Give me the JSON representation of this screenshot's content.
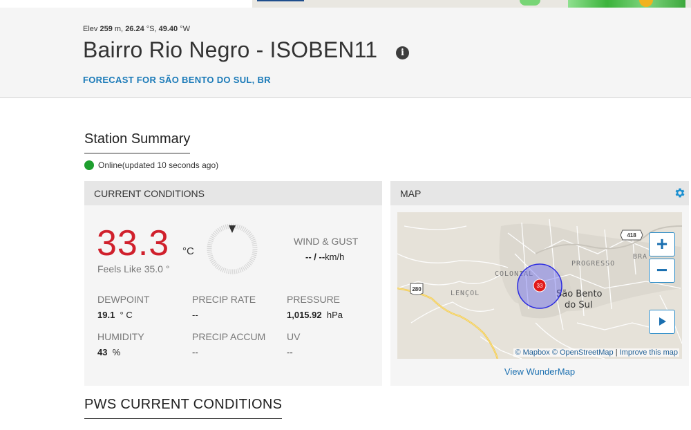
{
  "header": {
    "elev_label": "Elev",
    "elev_value": "259",
    "elev_unit": "m,",
    "lat_value": "26.24",
    "lat_unit": "°S,",
    "lon_value": "49.40",
    "lon_unit": "°W",
    "station_name": "Bairro Rio Negro - ISOBEN11",
    "info_icon": "info-icon",
    "forecast_link": "FORECAST FOR SÃO BENTO DO SUL, BR"
  },
  "summary": {
    "title": "Station Summary",
    "status_text": "Online(updated 10 seconds ago)",
    "status_color": "#1e9e2e"
  },
  "conditions": {
    "title": "CURRENT CONDITIONS",
    "temperature": "33.3",
    "temperature_unit": "°C",
    "feels_like": "Feels Like 35.0 °",
    "wind_label": "WIND & GUST",
    "wind_value": "-- / --",
    "wind_unit": "km/h",
    "dewpoint_label": "DEWPOINT",
    "dewpoint_value": "19.1",
    "dewpoint_unit": "° C",
    "precip_rate_label": "PRECIP RATE",
    "precip_rate_value": "--",
    "pressure_label": "PRESSURE",
    "pressure_value": "1,015.92",
    "pressure_unit": "hPa",
    "humidity_label": "HUMIDITY",
    "humidity_value": "43",
    "humidity_unit": "%",
    "precip_accum_label": "PRECIP ACCUM",
    "precip_accum_value": "--",
    "uv_label": "UV",
    "uv_value": "--",
    "temp_color": "#d0202c"
  },
  "map": {
    "title": "MAP",
    "settings_icon": "gear-icon",
    "zoom_in": "+",
    "zoom_out": "−",
    "play_icon": "play-icon",
    "marker_value": "33",
    "labels": {
      "colonial": "COLONIAL",
      "lencol": "LENÇOL",
      "progresso": "PROGRESSO",
      "bra": "BRA",
      "city_line1": "São Bento",
      "city_line2": "do Sul",
      "road_280": "280",
      "road_418": "418"
    },
    "attribution_mapbox": "© Mapbox",
    "attribution_osm": "© OpenStreetMap",
    "attribution_sep": "|",
    "attribution_improve": "Improve this map",
    "view_link": "View WunderMap"
  },
  "pws": {
    "title": "PWS CURRENT CONDITIONS"
  }
}
